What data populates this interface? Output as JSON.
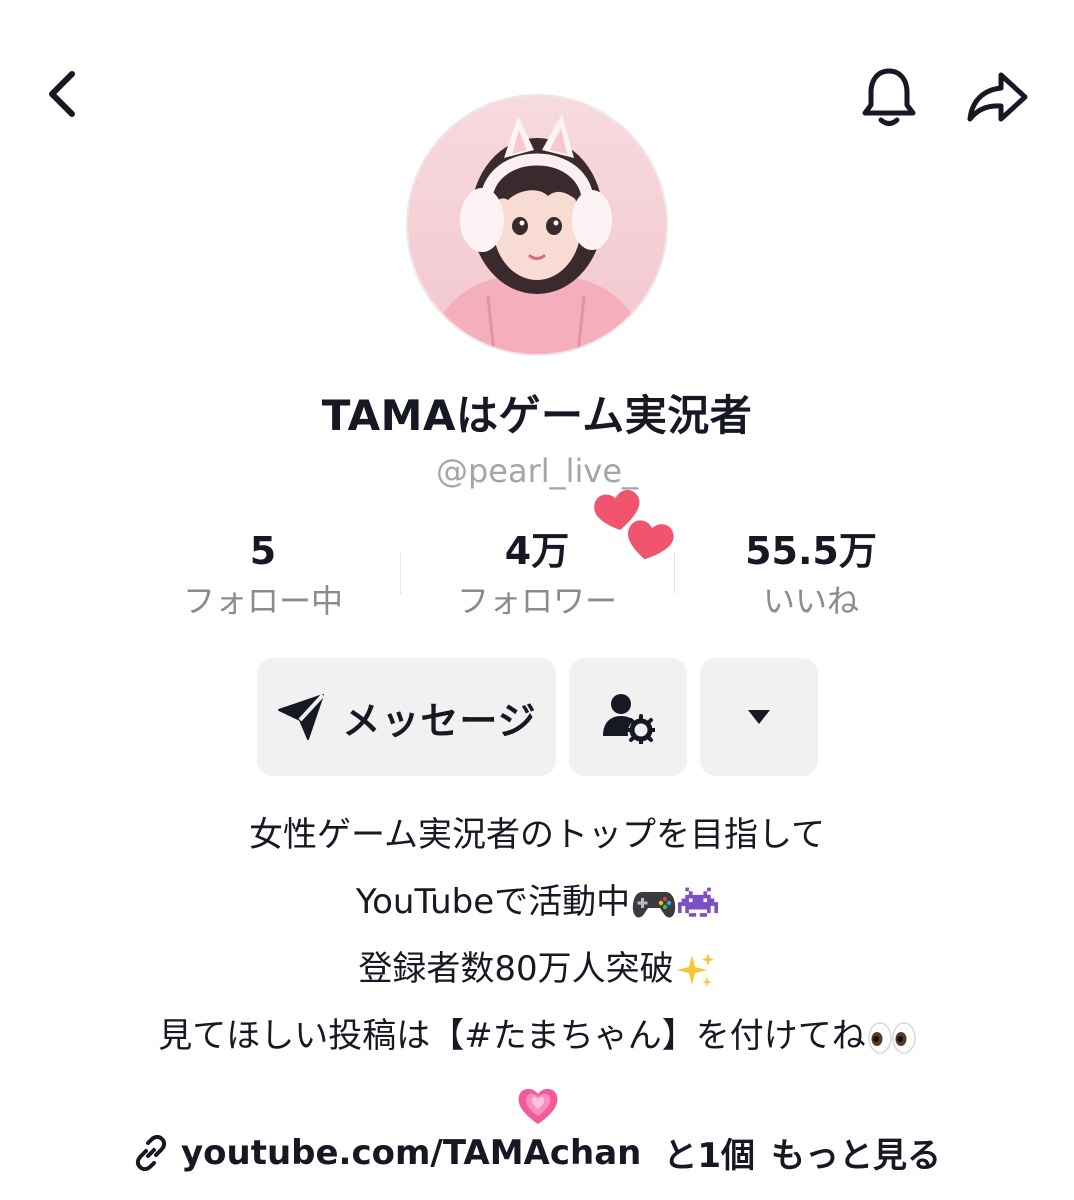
{
  "header": {
    "back_icon": "chevron-left-icon",
    "bell_icon": "bell-icon",
    "share_icon": "share-arrow-icon"
  },
  "profile": {
    "display_name": "TAMAはゲーム実況者",
    "handle": "@pearl_live_"
  },
  "stats": [
    {
      "value": "5",
      "label": "フォロー中"
    },
    {
      "value": "4万",
      "label": "フォロワー"
    },
    {
      "value": "55.5万",
      "label": "いいね"
    }
  ],
  "actions": {
    "message_label": "メッセージ",
    "message_icon": "send-icon",
    "profile_icon": "user-settings-icon",
    "more_icon": "caret-down-icon"
  },
  "bio": {
    "line1": "女性ゲーム実況者のトップを目指して",
    "line2": "YouTubeで活動中",
    "line3": "登録者数80万人突破",
    "line4": "見てほしい投稿は【#たまちゃん】を付けてね"
  },
  "link": {
    "url": "youtube.com/TAMAchan",
    "extra": "と1個",
    "more": "もっと見る",
    "icon": "link-icon"
  },
  "colors": {
    "text": "#161823",
    "muted": "#8a8b91",
    "button_bg": "#f1f1f2",
    "accent_pink": "#f0546e"
  }
}
